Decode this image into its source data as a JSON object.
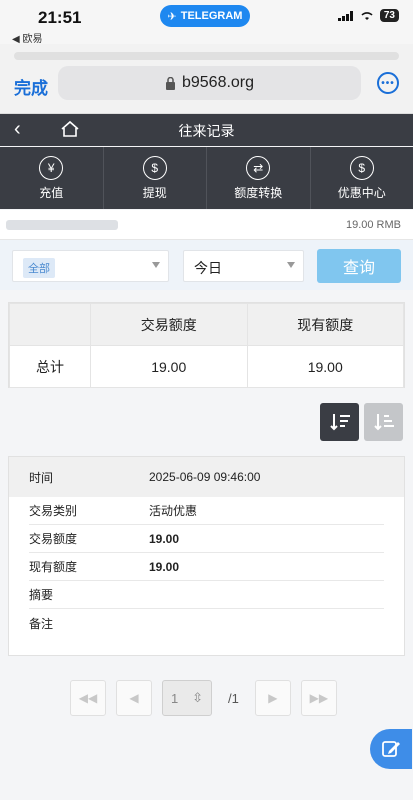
{
  "status_bar": {
    "time": "21:51",
    "back_label": "◀ 欧易",
    "pill_label": "TELEGRAM",
    "battery": "73"
  },
  "browser": {
    "done_label": "完成",
    "url": "b9568.org"
  },
  "nav": {
    "title": "往来记录"
  },
  "quick_actions": [
    {
      "label": "充值",
      "icon": "deposit-icon"
    },
    {
      "label": "提现",
      "icon": "withdraw-icon"
    },
    {
      "label": "额度转换",
      "icon": "transfer-icon"
    },
    {
      "label": "优惠中心",
      "icon": "promo-icon"
    }
  ],
  "user": {
    "balance": "19.00 RMB"
  },
  "filters": {
    "type_selected": "全部",
    "date_selected": "今日",
    "query_label": "查询"
  },
  "summary": {
    "headers": [
      "",
      "交易额度",
      "现有额度"
    ],
    "total_label": "总计",
    "total_amount": "19.00",
    "total_balance": "19.00"
  },
  "record": {
    "time_label": "时间",
    "time_value": "2025-06-09 09:46:00",
    "type_label": "交易类别",
    "type_value": "活动优惠",
    "amount_label": "交易额度",
    "amount_value": "19.00",
    "balance_label": "现有额度",
    "balance_value": "19.00",
    "summary_label": "摘要",
    "summary_value": "",
    "note_label": "备注",
    "note_value": ""
  },
  "pagination": {
    "current_page": "1",
    "total_pages": "/1"
  },
  "colors": {
    "nav_bg": "#3a3d44",
    "query_btn": "#80c6ef",
    "link_blue": "#1a6fd8",
    "fab": "#3e8de8"
  }
}
